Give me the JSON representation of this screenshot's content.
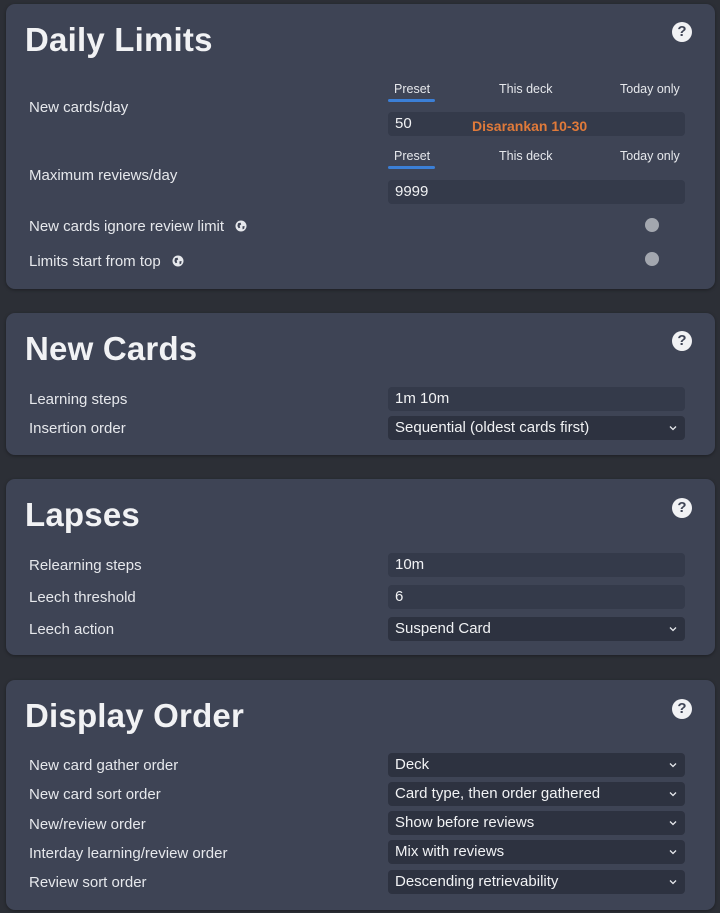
{
  "daily_limits": {
    "title": "Daily Limits",
    "help": "?",
    "tabs1": [
      "Preset",
      "This deck",
      "Today only"
    ],
    "new_cards_label": "New cards/day",
    "new_cards_value": "50",
    "new_cards_hint": "Disarankan 10-30",
    "tabs2": [
      "Preset",
      "This deck",
      "Today only"
    ],
    "max_reviews_label": "Maximum reviews/day",
    "max_reviews_value": "9999",
    "ignore_label": "New cards ignore review limit",
    "ignore_state": "off",
    "top_label": "Limits start from top",
    "top_state": "off"
  },
  "new_cards": {
    "title": "New Cards",
    "help": "?",
    "learning_steps_label": "Learning steps",
    "learning_steps_value": "1m 10m",
    "insertion_order_label": "Insertion order",
    "insertion_order_value": "Sequential (oldest cards first)"
  },
  "lapses": {
    "title": "Lapses",
    "help": "?",
    "relearning_label": "Relearning steps",
    "relearning_value": "10m",
    "leech_threshold_label": "Leech threshold",
    "leech_threshold_value": "6",
    "leech_action_label": "Leech action",
    "leech_action_value": "Suspend Card"
  },
  "display_order": {
    "title": "Display Order",
    "help": "?",
    "gather_label": "New card gather order",
    "gather_value": "Deck",
    "sort_label": "New card sort order",
    "sort_value": "Card type, then order gathered",
    "new_review_label": "New/review order",
    "new_review_value": "Show before reviews",
    "interday_label": "Interday learning/review order",
    "interday_value": "Mix with reviews",
    "review_sort_label": "Review sort order",
    "review_sort_value": "Descending retrievability"
  },
  "icons": {
    "help": "question-circle-icon",
    "globe": "globe-icon",
    "chevron": "chevron-down-icon"
  },
  "colors": {
    "background": "#2c2f36",
    "card": "#3e4455",
    "accent": "#3b7fd6",
    "hint": "#e07a3a"
  }
}
